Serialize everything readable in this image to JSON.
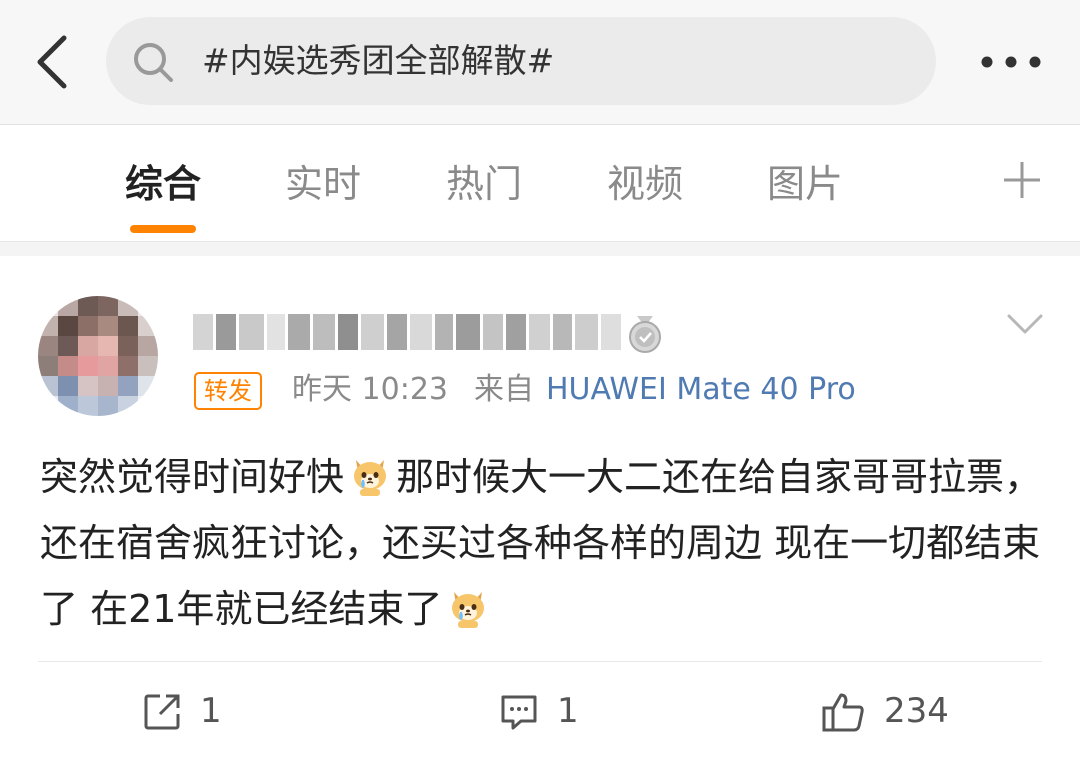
{
  "header": {
    "back_icon": "chevron-left-icon",
    "search_icon": "search-icon",
    "search_query": "#内娱选秀团全部解散#",
    "more_icon": "more-icon"
  },
  "tabs": [
    {
      "label": "综合",
      "active": true
    },
    {
      "label": "实时",
      "active": false
    },
    {
      "label": "热门",
      "active": false
    },
    {
      "label": "视频",
      "active": false
    },
    {
      "label": "图片",
      "active": false
    }
  ],
  "tab_add_icon": "plus-icon",
  "colors": {
    "accent": "#ff8200",
    "link": "#4f7ab2",
    "muted": "#8a8a8a",
    "text": "#222222"
  },
  "post": {
    "avatar": "avatar-pixelated",
    "username_icon": "pixelated-username",
    "badge_icon": "medal-badge-icon",
    "menu_icon": "chevron-down-icon",
    "repost_tag": "转发",
    "time": "昨天 10:23",
    "from_label": "来自",
    "device": "HUAWEI Mate 40 Pro",
    "text_part1": "突然觉得时间好快",
    "text_part2": "那时候大一大二还在给自家哥哥拉票，还在宿舍疯狂讨论，还买过各种各样的周边 现在一切都结束了 在21年就已经结束了",
    "emoji_icon": "crying-dog-emoji"
  },
  "actions": {
    "repost_count": "1",
    "comment_count": "1",
    "like_count": "234"
  }
}
